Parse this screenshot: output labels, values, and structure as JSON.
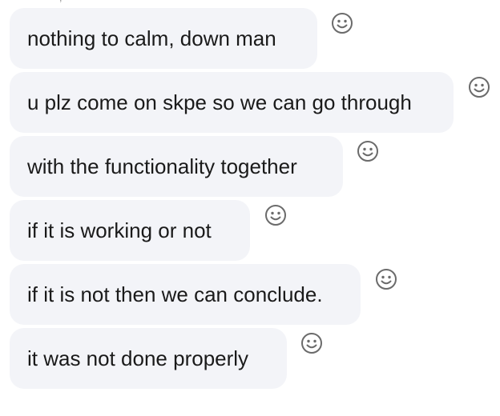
{
  "top_fragment": "— — ,",
  "messages": [
    {
      "text": "nothing to calm, down man",
      "reaction_icon": "smiley-reaction-icon"
    },
    {
      "text": "u plz come on skpe so we can go through",
      "reaction_icon": "smiley-reaction-icon"
    },
    {
      "text": "with the functionality together",
      "reaction_icon": "smiley-reaction-icon"
    },
    {
      "text": "if it is working or not",
      "reaction_icon": "smiley-reaction-icon"
    },
    {
      "text": "if it is not then we can conclude.",
      "reaction_icon": "smiley-reaction-icon"
    },
    {
      "text": "it was not done properly",
      "reaction_icon": "smiley-reaction-icon"
    }
  ],
  "colors": {
    "bubble": "#f3f4f8",
    "text": "#1a1a1a",
    "icon": "#6b6b6b"
  }
}
